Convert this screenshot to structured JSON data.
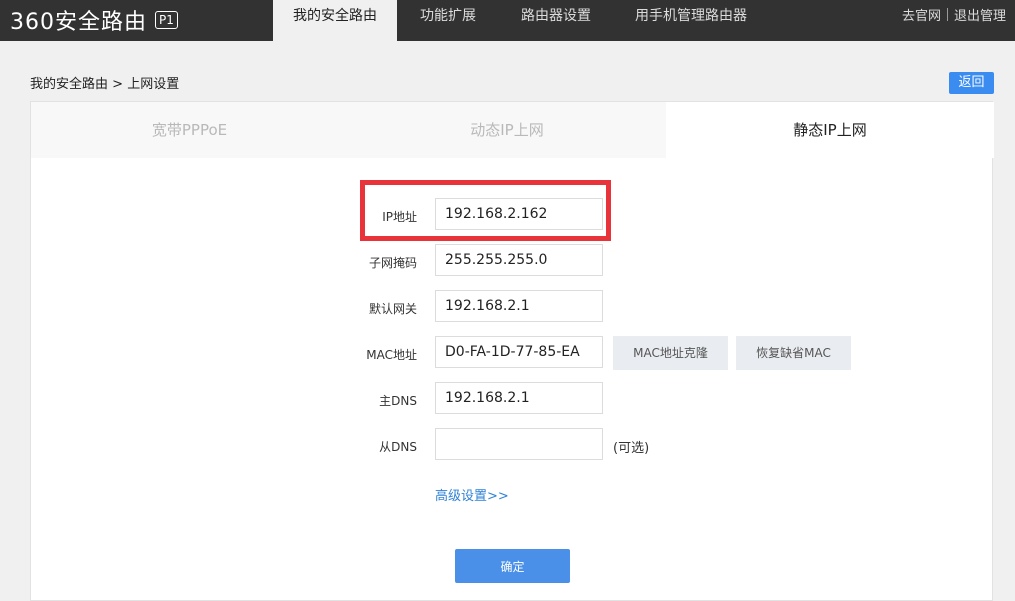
{
  "header": {
    "logo_text": "360安全路由",
    "logo_badge": "P1",
    "nav": {
      "my_router": "我的安全路由",
      "extensions": "功能扩展",
      "router_settings": "路由器设置",
      "mobile_manage": "用手机管理路由器"
    },
    "links": {
      "official_site": "去官网",
      "logout": "退出管理"
    }
  },
  "breadcrumb": {
    "root": "我的安全路由",
    "separator": ">",
    "current": "上网设置"
  },
  "back_label": "返回",
  "tabs": {
    "pppoe": "宽带PPPoE",
    "dhcp": "动态IP上网",
    "static": "静态IP上网"
  },
  "form": {
    "ip": {
      "label": "IP地址",
      "value": "192.168.2.162"
    },
    "subnet": {
      "label": "子网掩码",
      "value": "255.255.255.0"
    },
    "gateway": {
      "label": "默认网关",
      "value": "192.168.2.1"
    },
    "mac": {
      "label": "MAC地址",
      "value": "D0-FA-1D-77-85-EA",
      "clone_label": "MAC地址克隆",
      "restore_label": "恢复缺省MAC"
    },
    "dns1": {
      "label": "主DNS",
      "value": "192.168.2.1"
    },
    "dns2": {
      "label": "从DNS",
      "value": "",
      "note": "(可选)"
    },
    "advanced_label": "高级设置>>",
    "confirm_label": "确定"
  },
  "colors": {
    "topbar": "#333232",
    "accent_blue": "#3b8cf0",
    "highlight_red": "#e8333a",
    "link_blue": "#2f82d6"
  }
}
